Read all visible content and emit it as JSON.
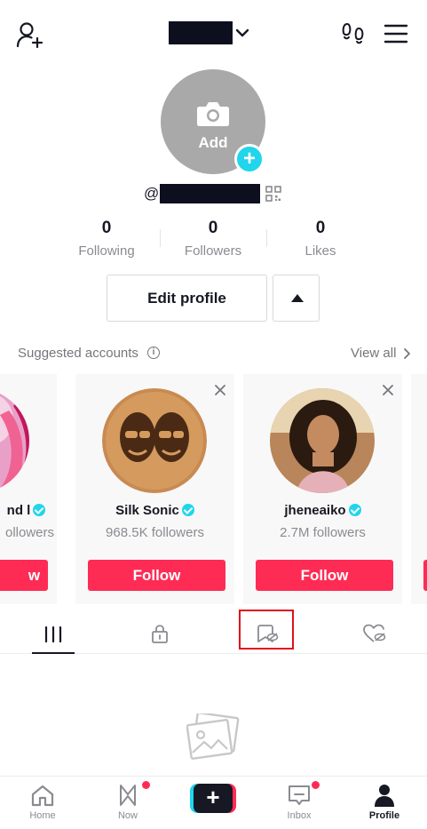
{
  "header": {
    "add_user_icon": "person-plus-icon",
    "username_dropdown_icon": "chevron-down-icon",
    "footprints_icon": "footprints-icon",
    "menu_icon": "hamburger-menu-icon"
  },
  "profile": {
    "avatar_label": "Add",
    "handle_prefix": "@",
    "stats": [
      {
        "value": "0",
        "label": "Following"
      },
      {
        "value": "0",
        "label": "Followers"
      },
      {
        "value": "0",
        "label": "Likes"
      }
    ],
    "edit_profile_label": "Edit profile"
  },
  "suggested": {
    "title": "Suggested accounts",
    "view_all_label": "View all",
    "cards": [
      {
        "name": "nd l",
        "followers": "ollowers",
        "button": "w"
      },
      {
        "name": "Silk Sonic",
        "followers": "968.5K followers",
        "button": "Follow"
      },
      {
        "name": "jheneaiko",
        "followers": "2.7M followers",
        "button": "Follow"
      }
    ]
  },
  "tabs": [
    {
      "icon": "grid-videos-icon",
      "active": true
    },
    {
      "icon": "lock-icon",
      "active": false
    },
    {
      "icon": "favorites-hidden-icon",
      "active": false
    },
    {
      "icon": "liked-hidden-icon",
      "active": false
    }
  ],
  "empty_state_icon": "photo-placeholder-icon",
  "nav": [
    {
      "label": "Home",
      "icon": "home-icon"
    },
    {
      "label": "Now",
      "icon": "now-icon",
      "badge": true
    },
    {
      "label": "",
      "icon": "create-plus-icon"
    },
    {
      "label": "Inbox",
      "icon": "inbox-icon",
      "badge": true
    },
    {
      "label": "Profile",
      "icon": "profile-icon",
      "active": true
    }
  ],
  "colors": {
    "accent_red": "#fe2c55",
    "accent_cyan": "#20d5ec",
    "text_primary": "#161823",
    "text_secondary": "#8a8b91"
  }
}
